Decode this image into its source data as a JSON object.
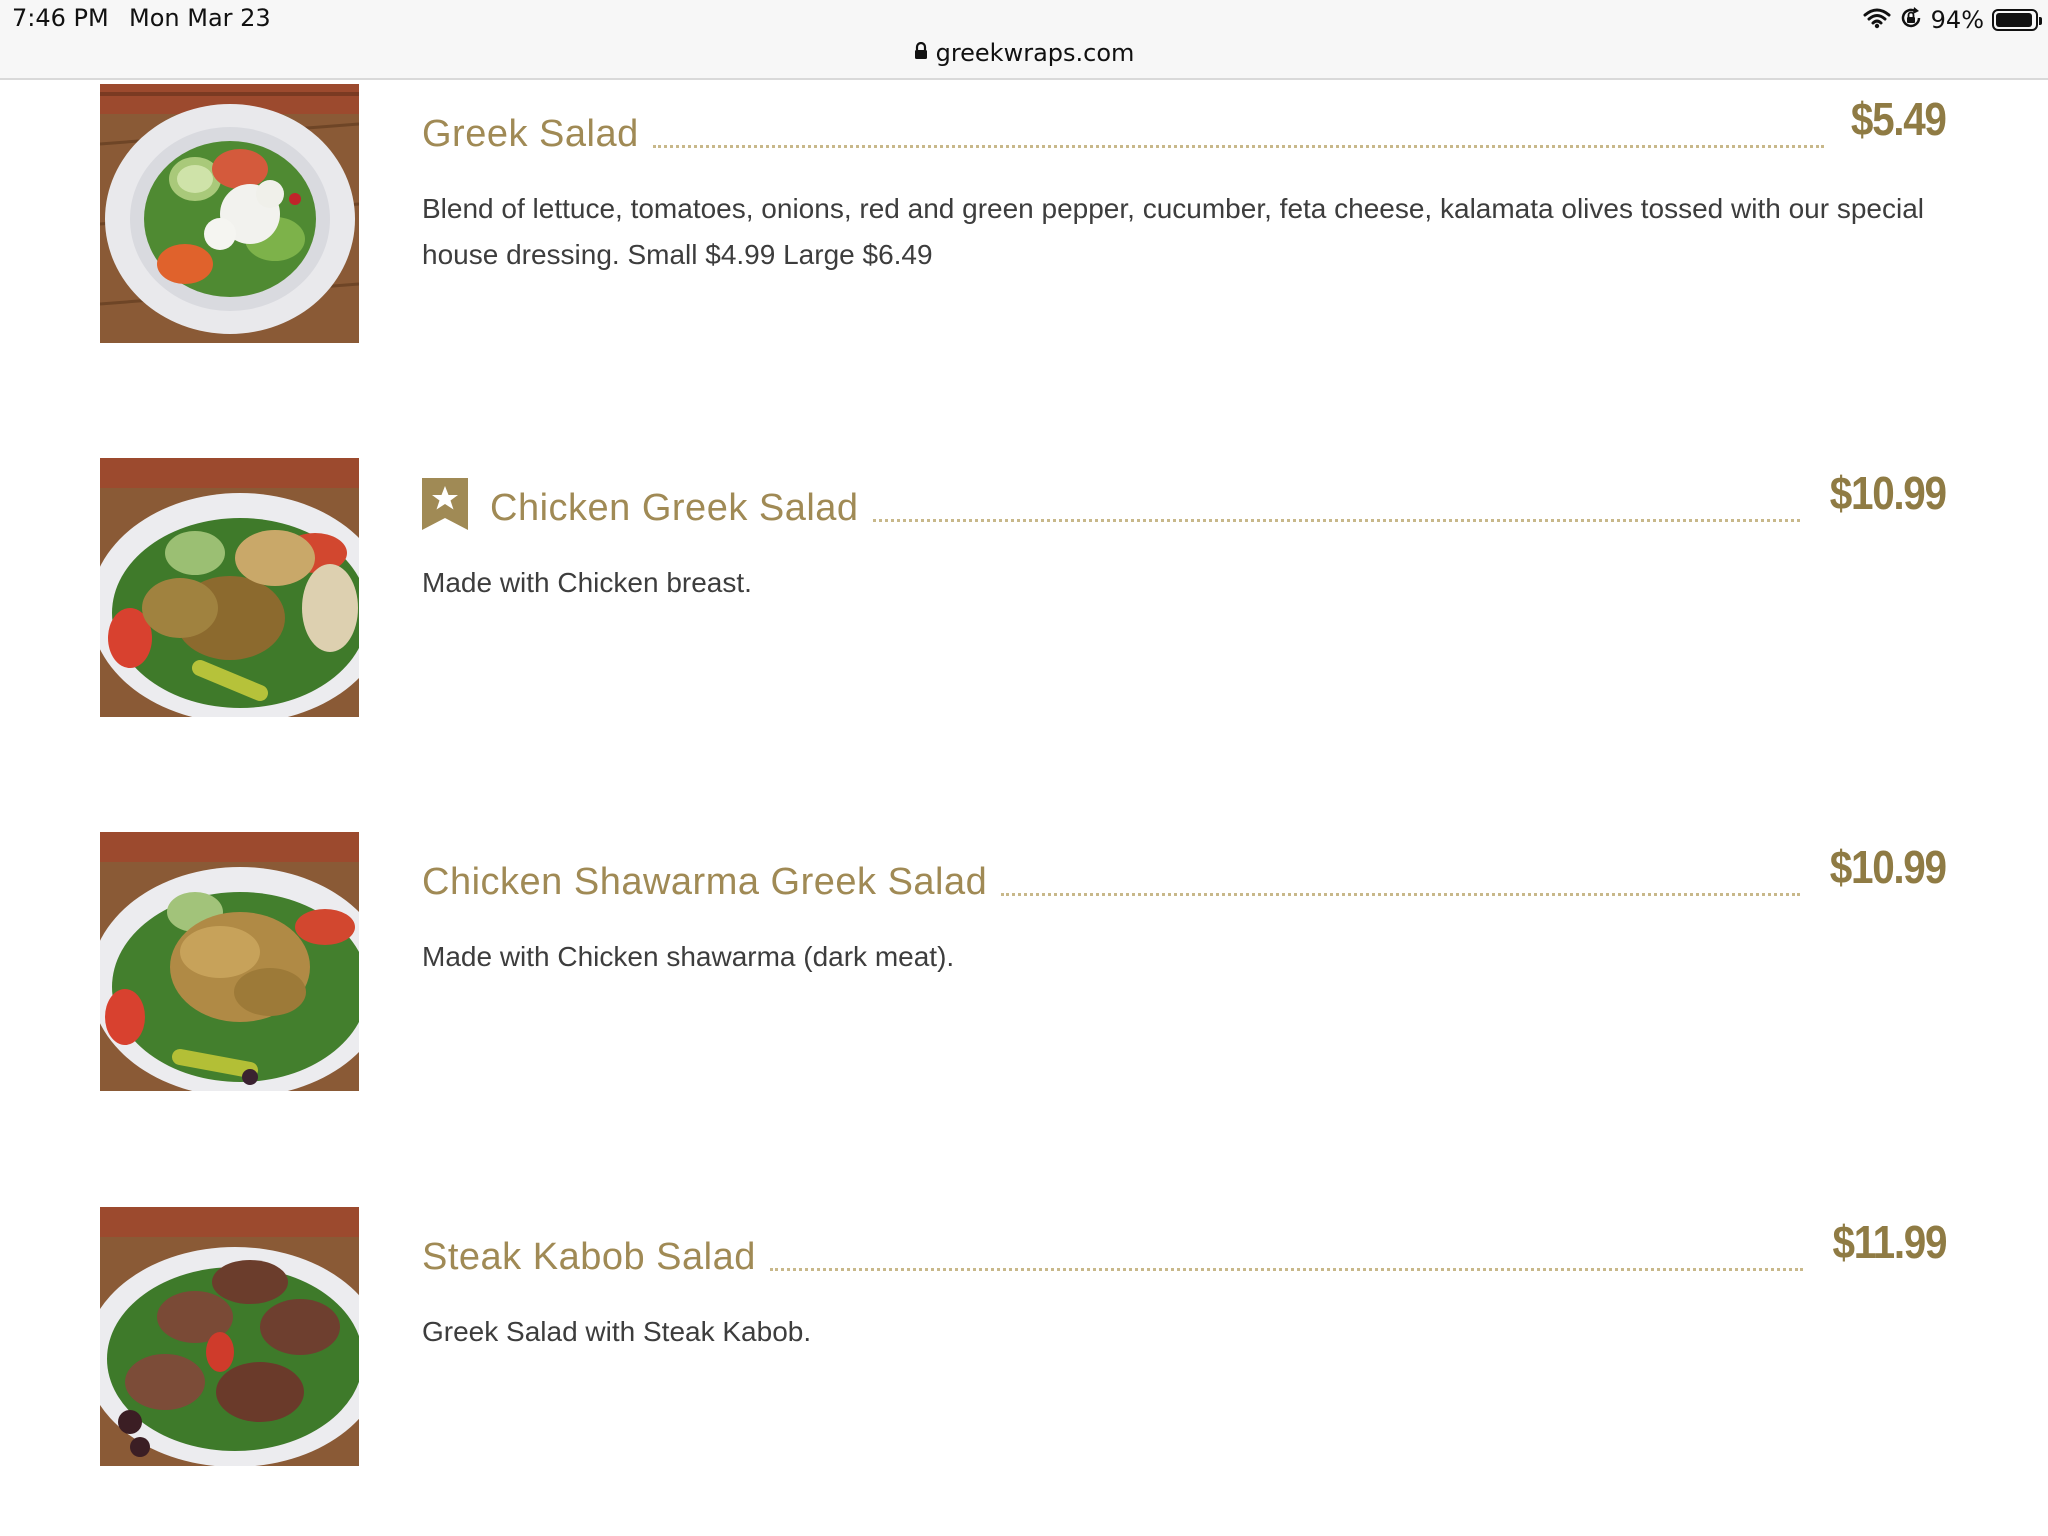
{
  "status": {
    "time": "7:46 PM",
    "date": "Mon Mar 23",
    "battery": "94%",
    "battery_level": 0.94
  },
  "browser": {
    "url": "greekwraps.com"
  },
  "colors": {
    "gold": "#a08a55",
    "price": "#8f7b44"
  },
  "menu": {
    "items": [
      {
        "name": "Greek Salad",
        "price": "$5.49",
        "description": "Blend of lettuce, tomatoes, onions, red and green pepper, cucumber, feta cheese, kalamata olives tossed with our special house dressing. Small $4.99 Large $6.49",
        "featured": false,
        "image": "greek-salad-bowl-image"
      },
      {
        "name": "Chicken Greek Salad",
        "price": "$10.99",
        "description": "Made with Chicken breast.",
        "featured": true,
        "image": "chicken-greek-salad-image"
      },
      {
        "name": "Chicken Shawarma Greek Salad",
        "price": "$10.99",
        "description": "Made with Chicken shawarma (dark meat).",
        "featured": false,
        "image": "chicken-shawarma-salad-image"
      },
      {
        "name": "Steak Kabob Salad",
        "price": "$11.99",
        "description": "Greek Salad with Steak Kabob.",
        "featured": false,
        "image": "steak-kabob-salad-image"
      }
    ]
  }
}
